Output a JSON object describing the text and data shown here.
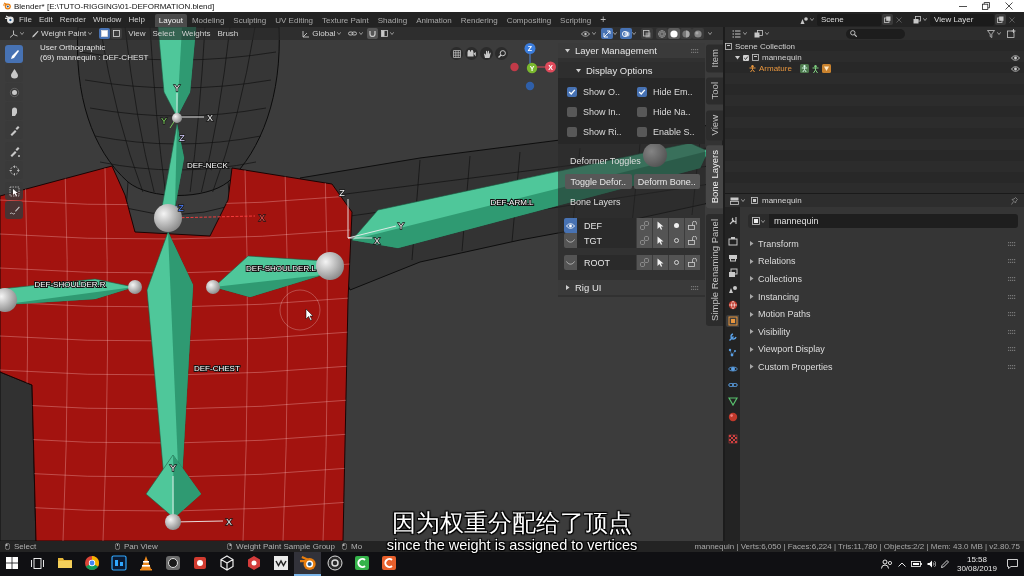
{
  "window": {
    "title": "Blender* [E:\\TUTO-RIGGING\\01-DEFORMATION.blend]"
  },
  "menu": [
    "File",
    "Edit",
    "Render",
    "Window",
    "Help"
  ],
  "workspaces": [
    {
      "label": "Layout",
      "selected": true
    },
    {
      "label": "Modeling",
      "selected": false
    },
    {
      "label": "Sculpting",
      "selected": false
    },
    {
      "label": "UV Editing",
      "selected": false
    },
    {
      "label": "Texture Paint",
      "selected": false
    },
    {
      "label": "Shading",
      "selected": false
    },
    {
      "label": "Animation",
      "selected": false
    },
    {
      "label": "Rendering",
      "selected": false
    },
    {
      "label": "Compositing",
      "selected": false
    },
    {
      "label": "Scripting",
      "selected": false
    }
  ],
  "add_workspace": "+",
  "scene": {
    "scene": "Scene",
    "view_layer": "View Layer"
  },
  "viewport_header": {
    "mode": "Weight Paint",
    "mask_toggles": [
      {
        "selected": true
      },
      {
        "selected": false
      }
    ],
    "menus": [
      "View",
      "Select",
      "Weights",
      "Brush"
    ],
    "orientation": "Global",
    "overlay_toggles": [
      {
        "kind": "gizmo",
        "on": true
      },
      {
        "kind": "overlay",
        "on": true
      },
      {
        "kind": "xray",
        "on": false
      }
    ],
    "shading_modes": [
      {
        "kind": "wireframe",
        "selected": false
      },
      {
        "kind": "solid",
        "selected": true
      },
      {
        "kind": "material",
        "selected": false
      },
      {
        "kind": "rendered",
        "selected": false
      }
    ]
  },
  "tools": [
    {
      "kind": "draw",
      "selected": true
    },
    {
      "kind": "blur",
      "selected": false
    },
    {
      "kind": "average",
      "selected": false
    },
    {
      "kind": "smear",
      "selected": false
    },
    {
      "kind": "sample",
      "selected": false
    },
    {
      "kind": "sample_group",
      "selected": false
    },
    {
      "kind": "cursor",
      "selected": false
    },
    {
      "kind": "select",
      "selected": false
    },
    {
      "kind": "annotate",
      "selected": false
    }
  ],
  "viewport": {
    "view_name": "User Orthographic",
    "object_info": "(69) mannequin : DEF-CHEST",
    "bone_labels": [
      "DEF-NECK",
      "DEF-ARM.L",
      "DEF-SHOULDER.R",
      "DEF-SHOULDER.L",
      "DEF-CHEST"
    ],
    "axis_labels": [
      "Y",
      "Y",
      "X",
      "Z",
      "Z",
      "X",
      "Z",
      "X",
      "Y",
      "Y",
      "X"
    ],
    "gizmo_axes": [
      "Z",
      "Y",
      "X"
    ]
  },
  "sidebar_tabs": [
    {
      "label": "Item",
      "selected": false
    },
    {
      "label": "Tool",
      "selected": false
    },
    {
      "label": "View",
      "selected": false
    },
    {
      "label": "Bone Layers",
      "selected": true
    },
    {
      "label": "Simple Renaming Panel",
      "selected": false
    }
  ],
  "layer_management": {
    "title": "Layer Management",
    "expanded": true,
    "display_options": {
      "title": "Display Options",
      "expanded": true,
      "checkboxes": [
        {
          "label": "Show O..",
          "checked": true
        },
        {
          "label": "Hide Em..",
          "checked": true
        },
        {
          "label": "Show In..",
          "checked": false
        },
        {
          "label": "Hide Na..",
          "checked": false
        },
        {
          "label": "Show Ri..",
          "checked": false
        },
        {
          "label": "Enable S..",
          "checked": false
        }
      ]
    },
    "deformer_toggles": {
      "title": "Deformer Toggles",
      "buttons": [
        "Toggle Defor..",
        "Deform Bone.."
      ]
    },
    "bone_layers": {
      "title": "Bone Layers",
      "layers": [
        {
          "name": "DEF",
          "visible": true,
          "active": true
        },
        {
          "name": "TGT",
          "visible": false,
          "active": false
        },
        {
          "name": "ROOT",
          "visible": false,
          "active": false
        }
      ]
    }
  },
  "rig_ui": {
    "title": "Rig UI",
    "expanded": false
  },
  "outliner": {
    "root": {
      "label": "Scene Collection",
      "children": [
        {
          "label": "mannequin",
          "kind": "collection",
          "expanded": true,
          "checked": true,
          "visible": true,
          "active": false,
          "children": [
            {
              "label": "Armature",
              "kind": "armature",
              "visible": true,
              "active": true
            }
          ]
        }
      ]
    }
  },
  "properties": {
    "header_object": "mannequin",
    "object_name": "mannequin",
    "tabs": [
      {
        "kind": "tool",
        "selected": false
      },
      {
        "kind": "render",
        "selected": false
      },
      {
        "kind": "output",
        "selected": false
      },
      {
        "kind": "view_layer",
        "selected": false
      },
      {
        "kind": "scene",
        "selected": false
      },
      {
        "kind": "world",
        "selected": false
      },
      {
        "kind": "object",
        "selected": true
      },
      {
        "kind": "modifiers",
        "selected": false
      },
      {
        "kind": "particles",
        "selected": false
      },
      {
        "kind": "physics",
        "selected": false
      },
      {
        "kind": "constraints",
        "selected": false
      },
      {
        "kind": "data",
        "selected": false
      },
      {
        "kind": "material",
        "selected": false
      },
      {
        "kind": "texture",
        "selected": false
      }
    ],
    "panels": [
      {
        "label": "Transform",
        "expanded": false
      },
      {
        "label": "Relations",
        "expanded": false
      },
      {
        "label": "Collections",
        "expanded": false
      },
      {
        "label": "Instancing",
        "expanded": false
      },
      {
        "label": "Motion Paths",
        "expanded": false
      },
      {
        "label": "Visibility",
        "expanded": false
      },
      {
        "label": "Viewport Display",
        "expanded": false
      },
      {
        "label": "Custom Properties",
        "expanded": false
      }
    ]
  },
  "status_bar": {
    "hints": [
      {
        "kind": "left",
        "label": "Select"
      },
      {
        "kind": "middle",
        "label": "Pan View"
      },
      {
        "kind": "right",
        "label": "Weight Paint Sample Group"
      },
      {
        "kind": "left",
        "label": "Mo"
      }
    ],
    "stats": "mannequin | Verts:6,050 | Faces:6,224 | Tris:11,780 | Objects:2/2 | Mem: 43.0 MB | v2.80.75"
  },
  "taskbar": {
    "apps": [
      {
        "kind": "explorer",
        "selected": false
      },
      {
        "kind": "browser",
        "selected": false
      },
      {
        "kind": "photo",
        "selected": false
      },
      {
        "kind": "cone",
        "selected": false
      },
      {
        "kind": "lens",
        "selected": false
      },
      {
        "kind": "red_app",
        "selected": false
      },
      {
        "kind": "cube",
        "selected": false
      },
      {
        "kind": "badge",
        "selected": false
      },
      {
        "kind": "zigzag",
        "selected": false
      },
      {
        "kind": "blender",
        "selected": true
      },
      {
        "kind": "ring",
        "selected": false
      },
      {
        "kind": "green_arc",
        "selected": false
      },
      {
        "kind": "orange_arc",
        "selected": false
      }
    ],
    "time": "15:58",
    "date": "30/08/2019"
  },
  "subtitles": {
    "chinese": "因为权重分配给了顶点",
    "english": "since the weight is assigned to vertices"
  }
}
